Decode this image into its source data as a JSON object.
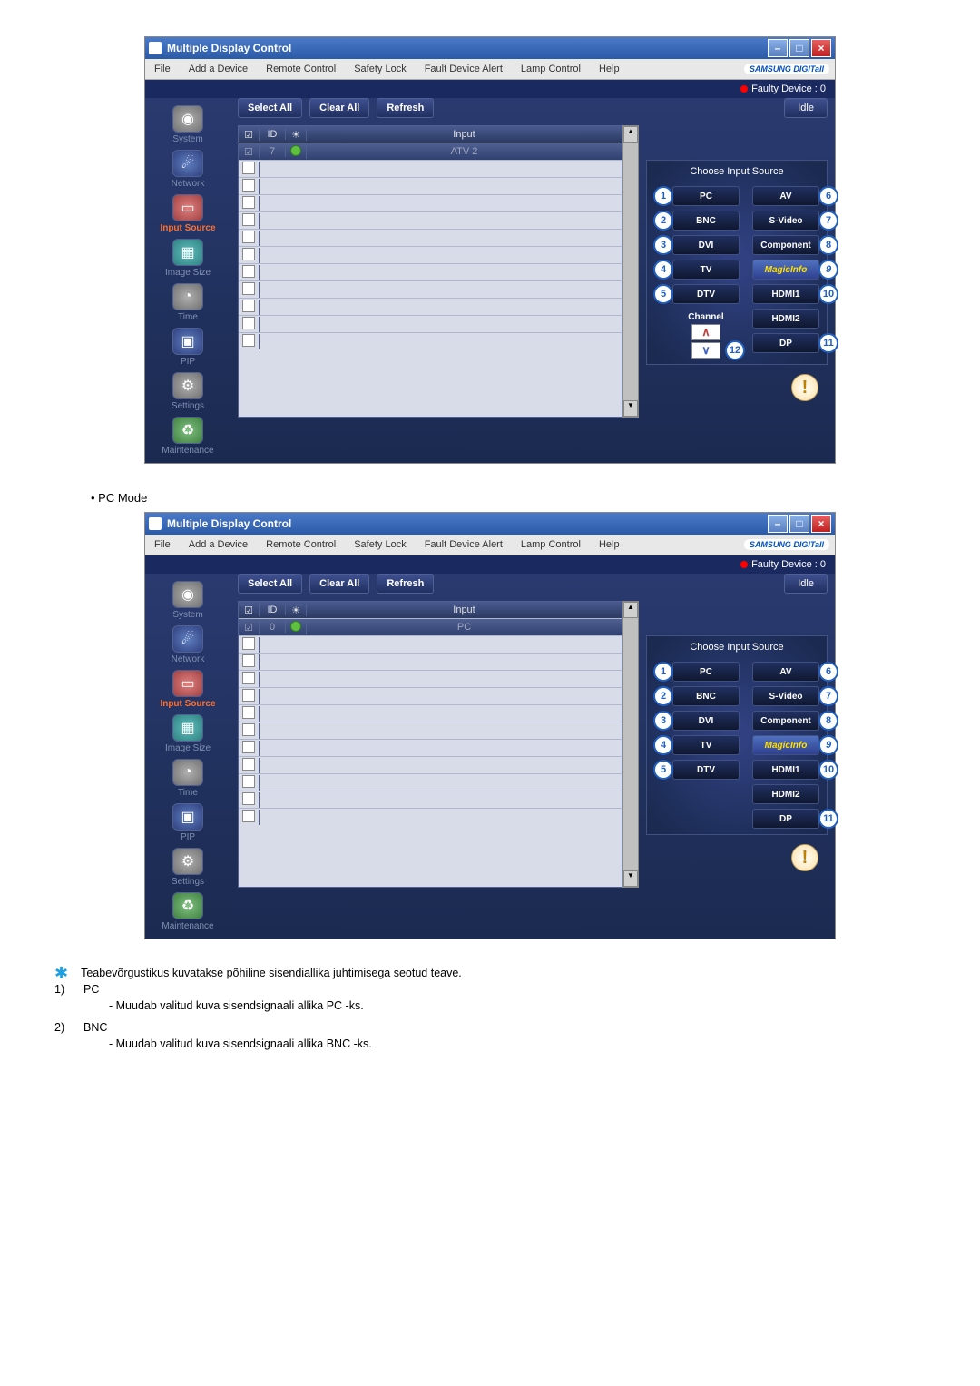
{
  "window_title": "Multiple Display Control",
  "menu": [
    "File",
    "Add a Device",
    "Remote Control",
    "Safety Lock",
    "Fault Device Alert",
    "Lamp Control",
    "Help"
  ],
  "brand": "SAMSUNG DIGITall",
  "fault_label": "Faulty Device : 0",
  "toolbar": {
    "select_all": "Select All",
    "clear_all": "Clear All",
    "refresh": "Refresh",
    "idle": "Idle"
  },
  "grid": {
    "head_id": "ID",
    "head_input": "Input"
  },
  "shot1": {
    "row_id": "7",
    "row_input": "ATV 2"
  },
  "shot2": {
    "row_id": "0",
    "row_input": "PC"
  },
  "sidebar": {
    "system": "System",
    "network": "Network",
    "input_source": "Input Source",
    "image_size": "Image Size",
    "time": "Time",
    "pip": "PIP",
    "settings": "Settings",
    "maintenance": "Maintenance"
  },
  "right": {
    "title": "Choose Input Source",
    "left_buttons": [
      "PC",
      "BNC",
      "DVI",
      "TV",
      "DTV"
    ],
    "right_buttons": [
      "AV",
      "S-Video",
      "Component",
      "MagicInfo",
      "HDMI1",
      "HDMI2",
      "DP"
    ],
    "channel": "Channel"
  },
  "caption_pc_mode": "•  PC Mode",
  "notes": {
    "intro": "Teabevõrgustikus kuvatakse põhiline sisendiallika juhtimisega seotud teave.",
    "n1_num": "1)",
    "n1_title": "PC",
    "n1_body": "- Muudab valitud kuva sisendsignaali allika PC -ks.",
    "n2_num": "2)",
    "n2_title": "BNC",
    "n2_body": "- Muudab valitud kuva sisendsignaali allika BNC -ks."
  }
}
